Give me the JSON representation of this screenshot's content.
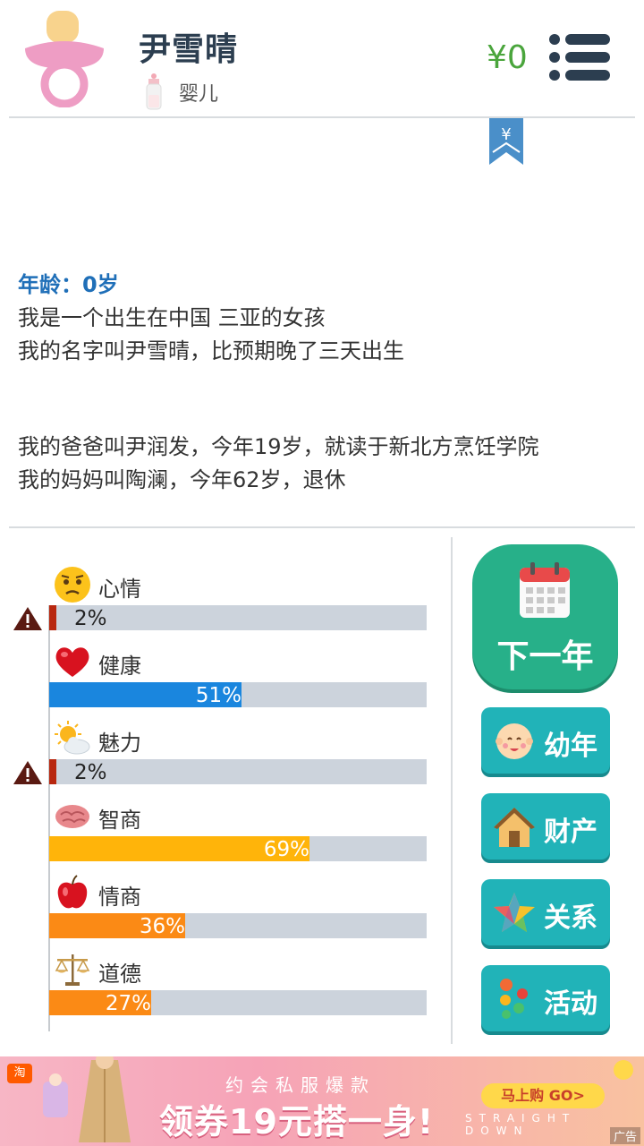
{
  "header": {
    "name": "尹雪晴",
    "stage": "婴儿",
    "money": "¥0"
  },
  "ribbon": {
    "symbol": "¥"
  },
  "story": {
    "age": "年龄：0岁",
    "lines1": [
      "我是一个出生在中国 三亚的女孩",
      "我的名字叫尹雪晴，比预期晚了三天出生"
    ],
    "lines2": [
      "我的爸爸叫尹润发，今年19岁，就读于新北方烹饪学院",
      "我的妈妈叫陶澜，今年62岁，退休"
    ]
  },
  "stats": [
    {
      "label": "心情",
      "value": 2,
      "text": "2%",
      "color": "#b8270f",
      "warn": true,
      "icon": "worried-face-icon"
    },
    {
      "label": "健康",
      "value": 51,
      "text": "51%",
      "color": "#1a86de",
      "warn": false,
      "icon": "heart-icon"
    },
    {
      "label": "魅力",
      "value": 2,
      "text": "2%",
      "color": "#b8270f",
      "warn": true,
      "icon": "sun-cloud-icon"
    },
    {
      "label": "智商",
      "value": 69,
      "text": "69%",
      "color": "#ffb40a",
      "warn": false,
      "icon": "brain-icon"
    },
    {
      "label": "情商",
      "value": 36,
      "text": "36%",
      "color": "#fb8a15",
      "warn": false,
      "icon": "apple-icon"
    },
    {
      "label": "道德",
      "value": 27,
      "text": "27%",
      "color": "#fb8a15",
      "warn": false,
      "icon": "scales-icon"
    }
  ],
  "buttons": {
    "next_year": "下一年",
    "childhood": "幼年",
    "property": "财产",
    "relations": "关系",
    "activities": "活动"
  },
  "ad": {
    "badge": "淘",
    "subtitle": "约会私服爆款",
    "headline": "领券19元搭一身!",
    "buy": "马上购 GO>",
    "english": "STRAIGHT DOWN",
    "tag": "广告"
  }
}
